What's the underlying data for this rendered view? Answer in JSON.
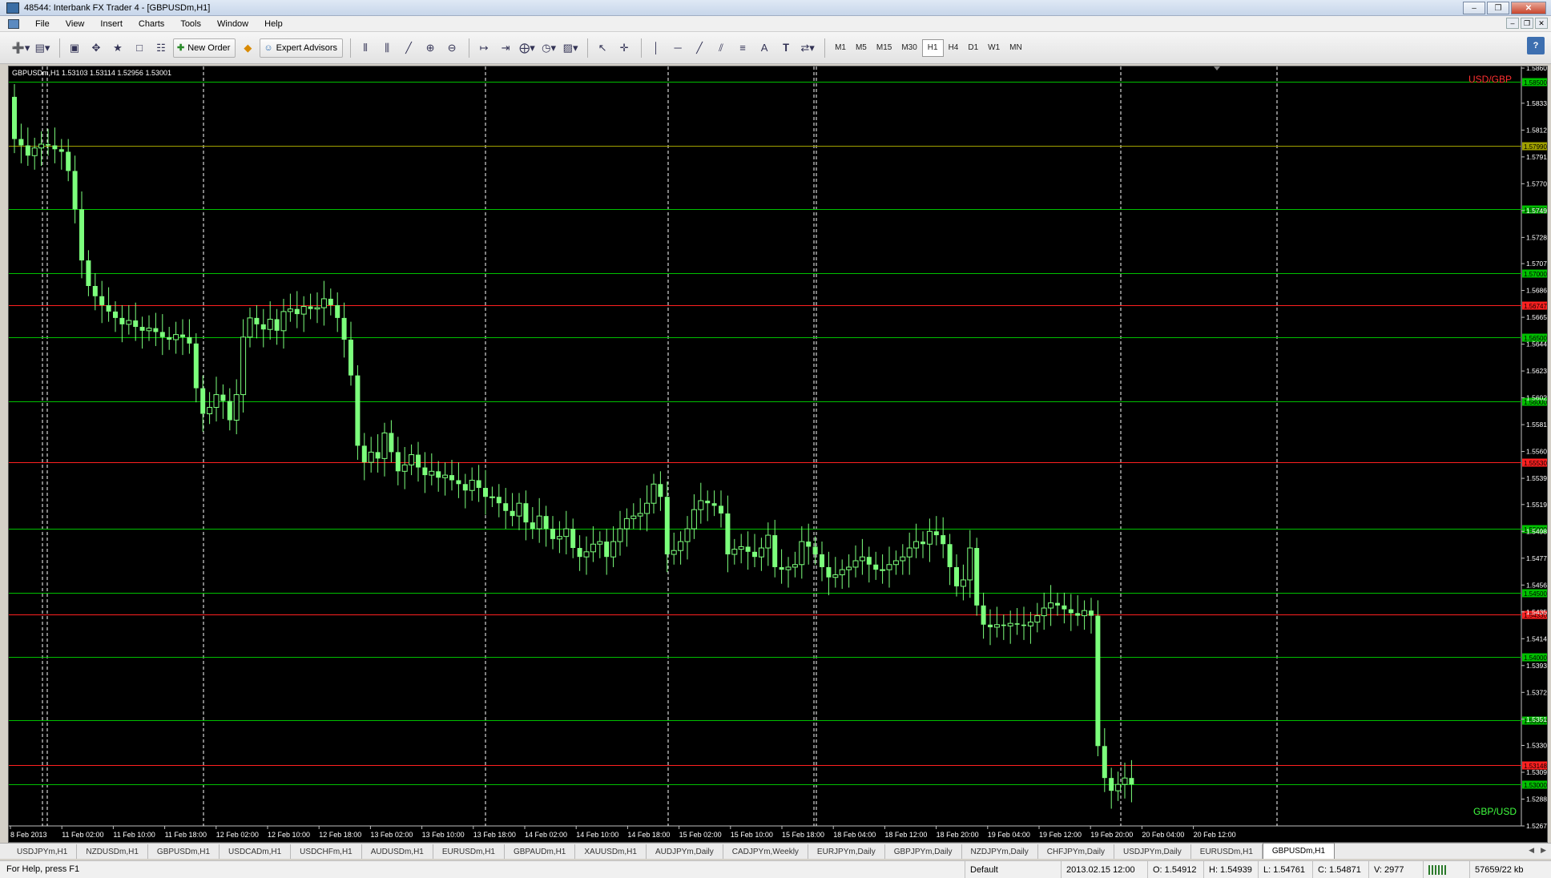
{
  "window": {
    "title": "48544: Interbank FX Trader 4 - [GBPUSDm,H1]",
    "buttons": [
      "minimize",
      "restore",
      "close"
    ]
  },
  "menu": {
    "items": [
      "File",
      "View",
      "Insert",
      "Charts",
      "Tools",
      "Window",
      "Help"
    ]
  },
  "toolbar": {
    "new_order_label": "New Order",
    "expert_advisors_label": "Expert Advisors",
    "timeframes": [
      "M1",
      "M5",
      "M15",
      "M30",
      "H1",
      "H4",
      "D1",
      "W1",
      "MN"
    ],
    "active_timeframe": "H1"
  },
  "chart": {
    "header": "GBPUSDm,H1  1.53103 1.53114 1.52956 1.53001",
    "top_right_label": "USD/GBP",
    "bottom_right_label": "GBP/USD",
    "colors": {
      "background": "#000000",
      "candle": "#7cff7c",
      "level_green": "#00c000",
      "level_red": "#ff2020",
      "level_olive": "#a0a000",
      "label_red": "#ff3030",
      "label_green": "#40ff40"
    }
  },
  "chart_data": {
    "type": "candlestick",
    "symbol": "GBPUSDm",
    "timeframe": "H1",
    "ylim": [
      1.52675,
      1.58605
    ],
    "y_ticks": [
      "1.58605",
      "1.58330",
      "1.58120",
      "1.57910",
      "1.57700",
      "1.57490",
      "1.57280",
      "1.57075",
      "1.56865",
      "1.56655",
      "1.56445",
      "1.56235",
      "1.56025",
      "1.55815",
      "1.55605",
      "1.55395",
      "1.55190",
      "1.54980",
      "1.54770",
      "1.54560",
      "1.54350",
      "1.54140",
      "1.53930",
      "1.53720",
      "1.53510",
      "1.53305",
      "1.53095",
      "1.52885",
      "1.52675"
    ],
    "x_ticks": [
      "8 Feb 2013",
      "11 Feb 02:00",
      "11 Feb 10:00",
      "11 Feb 18:00",
      "12 Feb 02:00",
      "12 Feb 10:00",
      "12 Feb 18:00",
      "13 Feb 02:00",
      "13 Feb 10:00",
      "13 Feb 18:00",
      "14 Feb 02:00",
      "14 Feb 10:00",
      "14 Feb 18:00",
      "15 Feb 02:00",
      "15 Feb 10:00",
      "15 Feb 18:00",
      "18 Feb 04:00",
      "18 Feb 12:00",
      "18 Feb 20:00",
      "19 Feb 04:00",
      "19 Feb 12:00",
      "19 Feb 20:00",
      "20 Feb 04:00",
      "20 Feb 12:00"
    ],
    "horizontal_levels": [
      {
        "price": 1.585,
        "label": "1.58500",
        "color": "green"
      },
      {
        "price": 1.58,
        "label": "1.57990",
        "color": "olive"
      },
      {
        "price": 1.575,
        "label": "1.57500",
        "color": "green"
      },
      {
        "price": 1.57,
        "label": "1.57000",
        "color": "green"
      },
      {
        "price": 1.5675,
        "label": "1.56747",
        "color": "red"
      },
      {
        "price": 1.565,
        "label": "1.56500",
        "color": "green"
      },
      {
        "price": 1.56,
        "label": "1.56000",
        "color": "green"
      },
      {
        "price": 1.5552,
        "label": "1.55530",
        "color": "red"
      },
      {
        "price": 1.55,
        "label": "1.55000",
        "color": "green"
      },
      {
        "price": 1.545,
        "label": "1.54500",
        "color": "green"
      },
      {
        "price": 1.5433,
        "label": "1.54330",
        "color": "red"
      },
      {
        "price": 1.54,
        "label": "1.54000",
        "color": "green"
      },
      {
        "price": 1.535,
        "label": "1.53500",
        "color": "green"
      },
      {
        "price": 1.5315,
        "label": "1.53148",
        "color": "red"
      },
      {
        "price": 1.53,
        "label": "1.53000",
        "color": "green"
      }
    ],
    "price_path": [
      1.5838,
      1.5805,
      1.58,
      1.5792,
      1.5798,
      1.5801,
      1.58,
      1.5797,
      1.5795,
      1.578,
      1.575,
      1.571,
      1.569,
      1.5682,
      1.5675,
      1.567,
      1.5665,
      1.566,
      1.5663,
      1.5658,
      1.5655,
      1.5657,
      1.5654,
      1.565,
      1.5648,
      1.5652,
      1.565,
      1.5645,
      1.561,
      1.559,
      1.5595,
      1.5605,
      1.56,
      1.5585,
      1.5605,
      1.565,
      1.5665,
      1.566,
      1.5656,
      1.5664,
      1.5655,
      1.567,
      1.5672,
      1.5668,
      1.5674,
      1.5672,
      1.5673,
      1.568,
      1.5675,
      1.5665,
      1.5648,
      1.562,
      1.5565,
      1.5552,
      1.556,
      1.5555,
      1.5575,
      1.556,
      1.5545,
      1.555,
      1.5558,
      1.5548,
      1.5542,
      1.5545,
      1.554,
      1.5542,
      1.5538,
      1.5535,
      1.553,
      1.5538,
      1.5532,
      1.5525,
      1.5525,
      1.552,
      1.5514,
      1.551,
      1.552,
      1.5505,
      1.55,
      1.551,
      1.55,
      1.5492,
      1.5494,
      1.55,
      1.5485,
      1.5478,
      1.5482,
      1.5488,
      1.549,
      1.5478,
      1.549,
      1.55,
      1.5508,
      1.551,
      1.5512,
      1.552,
      1.5535,
      1.5525,
      1.548,
      1.5483,
      1.549,
      1.55,
      1.5515,
      1.5522,
      1.552,
      1.5518,
      1.5512,
      1.548,
      1.5484,
      1.5486,
      1.5482,
      1.5478,
      1.5485,
      1.5495,
      1.547,
      1.5468,
      1.547,
      1.5472,
      1.549,
      1.5486,
      1.548,
      1.547,
      1.5462,
      1.5464,
      1.5468,
      1.547,
      1.5475,
      1.5478,
      1.5472,
      1.5468,
      1.5468,
      1.5472,
      1.5475,
      1.5478,
      1.5485,
      1.549,
      1.5488,
      1.5498,
      1.5495,
      1.5488,
      1.547,
      1.5455,
      1.546,
      1.5485,
      1.544,
      1.5425,
      1.5423,
      1.5425,
      1.5424,
      1.5426,
      1.5425,
      1.5424,
      1.5427,
      1.5432,
      1.5438,
      1.5442,
      1.544,
      1.5437,
      1.5434,
      1.5432,
      1.5436,
      1.5432,
      1.533,
      1.5305,
      1.5295,
      1.53,
      1.5305,
      1.53
    ],
    "start_label": "8 Feb 2013",
    "end_label": "20 Feb 12:00"
  },
  "tabs": {
    "items": [
      "USDJPYm,H1",
      "NZDUSDm,H1",
      "GBPUSDm,H1",
      "USDCADm,H1",
      "USDCHFm,H1",
      "AUDUSDm,H1",
      "EURUSDm,H1",
      "GBPAUDm,H1",
      "XAUUSDm,H1",
      "AUDJPYm,Daily",
      "CADJPYm,Weekly",
      "EURJPYm,Daily",
      "GBPJPYm,Daily",
      "NZDJPYm,Daily",
      "CHFJPYm,Daily",
      "USDJPYm,Daily",
      "EURUSDm,H1",
      "GBPUSDm,H1"
    ],
    "active": "GBPUSDm,H1"
  },
  "status": {
    "help": "For Help, press F1",
    "profile": "Default",
    "datetime": "2013.02.15 12:00",
    "open": "O: 1.54912",
    "high": "H: 1.54939",
    "low": "L: 1.54761",
    "close": "C: 1.54871",
    "volume": "V: 2977",
    "traffic": "57659/22 kb"
  }
}
